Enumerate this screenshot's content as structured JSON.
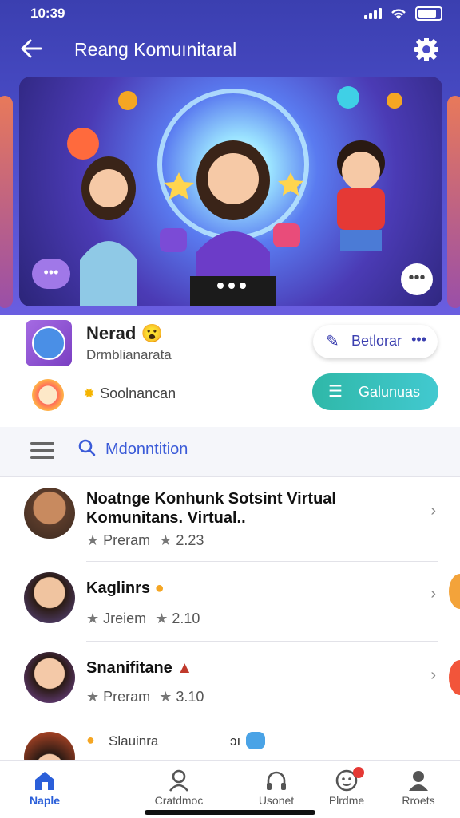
{
  "status": {
    "time": "10:39"
  },
  "header": {
    "title": "Reang Komuınitaral"
  },
  "profile": {
    "name": "Nerad",
    "emoji": "😮",
    "subtitle": "Drmblianarata",
    "button1_label": "Betlorar",
    "button1_dots": "•••",
    "sun_label": "Soolnancan",
    "button2_label": "Galunuas"
  },
  "search": {
    "label": "Mdonntition"
  },
  "list": {
    "items": [
      {
        "title": "Noatnge Konhunk Sotsint Virtual Komunitans. Virtual..",
        "meta": "Preram",
        "rating": "2.23"
      },
      {
        "title": "Kaglinrs",
        "meta": "Jreiem",
        "rating": "2.10"
      },
      {
        "title": "Snanifitane",
        "meta": "Preram",
        "rating": "3.10"
      },
      {
        "title": "Slauinra",
        "meta": "",
        "rating": ""
      }
    ],
    "partial_extra": "ɔı"
  },
  "nav": {
    "items": [
      {
        "label": "Naple"
      },
      {
        "label": "Cratdmoc"
      },
      {
        "label": "Usonet"
      },
      {
        "label": "Plrdme"
      },
      {
        "label": "Rroets"
      }
    ]
  }
}
